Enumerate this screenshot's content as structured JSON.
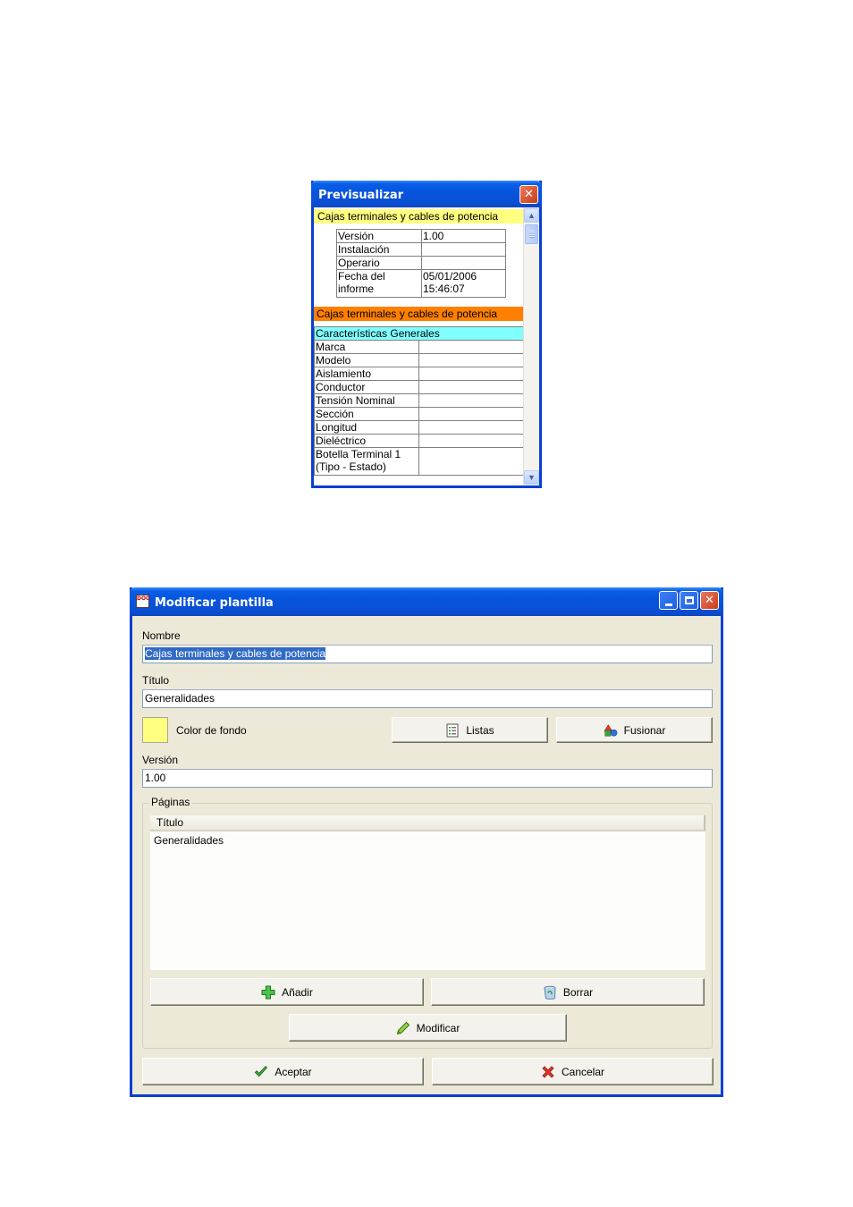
{
  "preview": {
    "title": "Previsualizar",
    "header_yellow": "Cajas terminales y cables de potencia",
    "info_rows": [
      {
        "label": "Versión",
        "value": "1.00"
      },
      {
        "label": "Instalación",
        "value": ""
      },
      {
        "label": "Operario",
        "value": ""
      },
      {
        "label": "Fecha del informe",
        "value": "05/01/2006 15:46:07"
      }
    ],
    "header_orange": "Cajas terminales y cables de potencia",
    "section_title": "Características Generales",
    "rows": [
      "Marca",
      "Modelo",
      "Aislamiento",
      "Conductor",
      "Tensión Nominal",
      "Sección",
      "Longitud",
      "Dieléctrico",
      "Botella Terminal 1 (Tipo - Estado)"
    ],
    "colors": {
      "yellow": "#ffff80",
      "orange": "#ff8000",
      "cyan": "#80ffff"
    }
  },
  "dialog": {
    "title": "Modificar plantilla",
    "app_icon_text": "DOC",
    "nombre_label": "Nombre",
    "nombre_value": "Cajas terminales y cables de potencia",
    "titulo_label": "Título",
    "titulo_value": "Generalidades",
    "color_label": "Color de fondo",
    "color_value": "#ffff80",
    "listas_label": "Listas",
    "fusionar_label": "Fusionar",
    "version_label": "Versión",
    "version_value": "1.00",
    "paginas_label": "Páginas",
    "paginas_column": "Título",
    "paginas_items": [
      "Generalidades"
    ],
    "anadir_label": "Añadir",
    "borrar_label": "Borrar",
    "modificar_label": "Modificar",
    "aceptar_label": "Aceptar",
    "cancelar_label": "Cancelar"
  }
}
